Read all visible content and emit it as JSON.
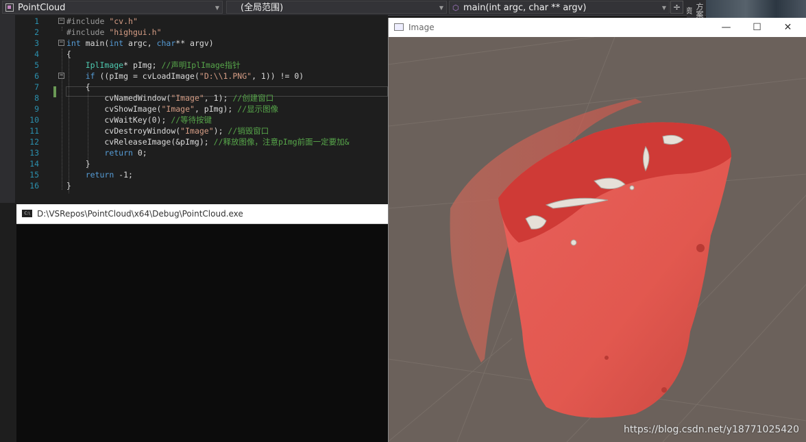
{
  "nav": {
    "project": "PointCloud",
    "scope": "(全局范围)",
    "member": "main(int argc, char ** argv)",
    "split_glyph": "÷",
    "side_tab": "方案资"
  },
  "editor": {
    "lines": [
      {
        "n": "1",
        "html": "<span class=\"pp\">#include</span> <span class=\"str\">\"cv.h\"</span>",
        "fold": "⊟"
      },
      {
        "n": "2",
        "html": "<span class=\"pp\">#include</span> <span class=\"str\">\"highgui.h\"</span>",
        "fold": ""
      },
      {
        "n": "3",
        "html": "<span class=\"kw\">int</span> main(<span class=\"kw\">int</span> argc, <span class=\"kw\">char</span>** argv)",
        "fold": "⊟"
      },
      {
        "n": "4",
        "html": "{",
        "fold": ""
      },
      {
        "n": "5",
        "html": "    <span class=\"typ\">IplImage</span>* pImg; <span class=\"cmt\">//声明IplImage指针</span>",
        "fold": ""
      },
      {
        "n": "6",
        "html": "    <span class=\"kw\">if</span> ((pImg = cvLoadImage(<span class=\"str\">\"D:\\\\1.PNG\"</span>, 1)) != 0)",
        "fold": "⊟"
      },
      {
        "n": "7",
        "html": "    {",
        "fold": ""
      },
      {
        "n": "8",
        "html": "        cvNamedWindow(<span class=\"str\">\"Image\"</span>, 1); <span class=\"cmt\">//创建窗口</span>",
        "fold": ""
      },
      {
        "n": "9",
        "html": "        cvShowImage(<span class=\"str\">\"Image\"</span>, pImg); <span class=\"cmt\">//显示图像</span>",
        "fold": ""
      },
      {
        "n": "10",
        "html": "        cvWaitKey(0); <span class=\"cmt\">//等待按键</span>",
        "fold": ""
      },
      {
        "n": "11",
        "html": "        cvDestroyWindow(<span class=\"str\">\"Image\"</span>); <span class=\"cmt\">//销毁窗口</span>",
        "fold": ""
      },
      {
        "n": "12",
        "html": "        cvReleaseImage(&amp;pImg); <span class=\"cmt\">//释放图像，注意pImg前面一定要加&amp;</span>",
        "fold": ""
      },
      {
        "n": "13",
        "html": "        <span class=\"kw\">return</span> 0;",
        "fold": ""
      },
      {
        "n": "14",
        "html": "    }",
        "fold": ""
      },
      {
        "n": "15",
        "html": "    <span class=\"kw\">return</span> -1;",
        "fold": ""
      },
      {
        "n": "16",
        "html": "}",
        "fold": ""
      }
    ]
  },
  "console": {
    "title": "D:\\VSRepos\\PointCloud\\x64\\Debug\\PointCloud.exe",
    "icon_text": "C:\\"
  },
  "image_window": {
    "title": "Image",
    "minimize": "—",
    "maximize": "☐",
    "close": "✕"
  },
  "watermark": "https://blog.csdn.net/y18771025420"
}
